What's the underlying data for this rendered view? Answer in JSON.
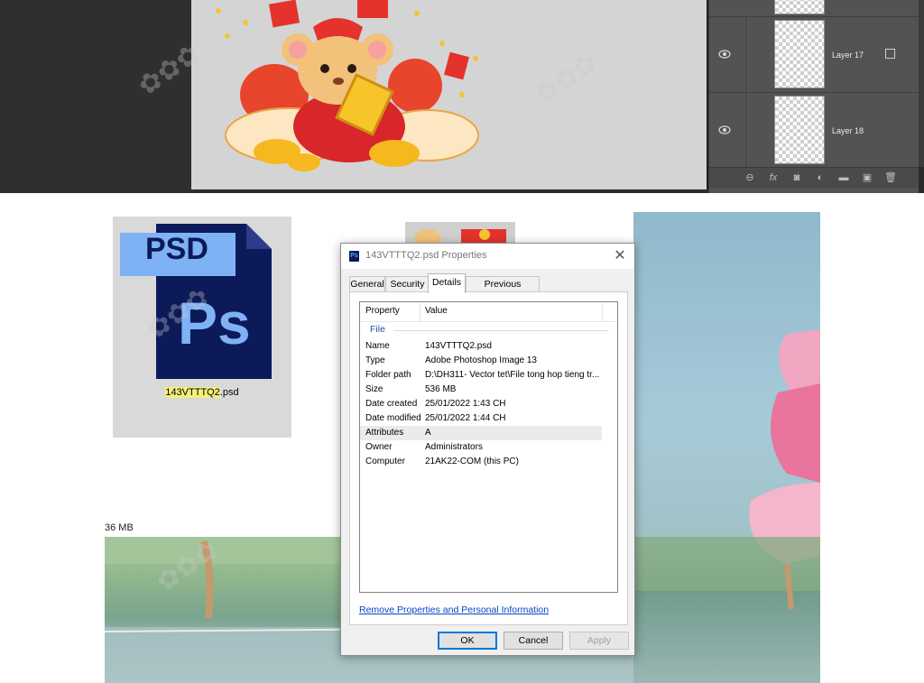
{
  "photoshop": {
    "layers": [
      {
        "name": ""
      },
      {
        "name": "Layer 17"
      },
      {
        "name": "Layer 18"
      }
    ],
    "toolbar_icons": [
      "link-icon",
      "fx-icon",
      "mask-icon",
      "adjustment-icon",
      "folder-icon",
      "new-layer-icon",
      "trash-icon"
    ]
  },
  "explorer": {
    "file_icon_label_top": "PSD",
    "file_icon_label_ps": "Ps",
    "file_name_highlight": "143VTTTQ2",
    "file_name_rest": ".psd",
    "size_label": "36 MB"
  },
  "dialog": {
    "title": "143VTTTQ2.psd Properties",
    "close_glyph": "✕",
    "tabs": [
      {
        "label": "General",
        "active": false
      },
      {
        "label": "Security",
        "active": false
      },
      {
        "label": "Details",
        "active": true
      },
      {
        "label": "Previous Versions",
        "active": false
      }
    ],
    "columns": {
      "property": "Property",
      "value": "Value"
    },
    "group": "File",
    "rows": [
      {
        "name": "Name",
        "value": "143VTTTQ2.psd"
      },
      {
        "name": "Type",
        "value": "Adobe Photoshop Image 13"
      },
      {
        "name": "Folder path",
        "value": "D:\\DH311- Vector tet\\File tong hop tieng tr..."
      },
      {
        "name": "Size",
        "value": "536 MB"
      },
      {
        "name": "Date created",
        "value": "25/01/2022 1:43 CH"
      },
      {
        "name": "Date modified",
        "value": "25/01/2022 1:44 CH"
      },
      {
        "name": "Attributes",
        "value": "A"
      },
      {
        "name": "Owner",
        "value": "Administrators"
      },
      {
        "name": "Computer",
        "value": "21AK22-COM (this PC)"
      }
    ],
    "remove_link": "Remove Properties and Personal Information",
    "buttons": {
      "ok": "OK",
      "cancel": "Cancel",
      "apply": "Apply"
    }
  },
  "colors": {
    "accent": "#0078d7",
    "link": "#0645c4",
    "psd_blue": "#0c1a5a",
    "psd_light": "#7fb2f5",
    "highlight": "#f5ef7a"
  }
}
